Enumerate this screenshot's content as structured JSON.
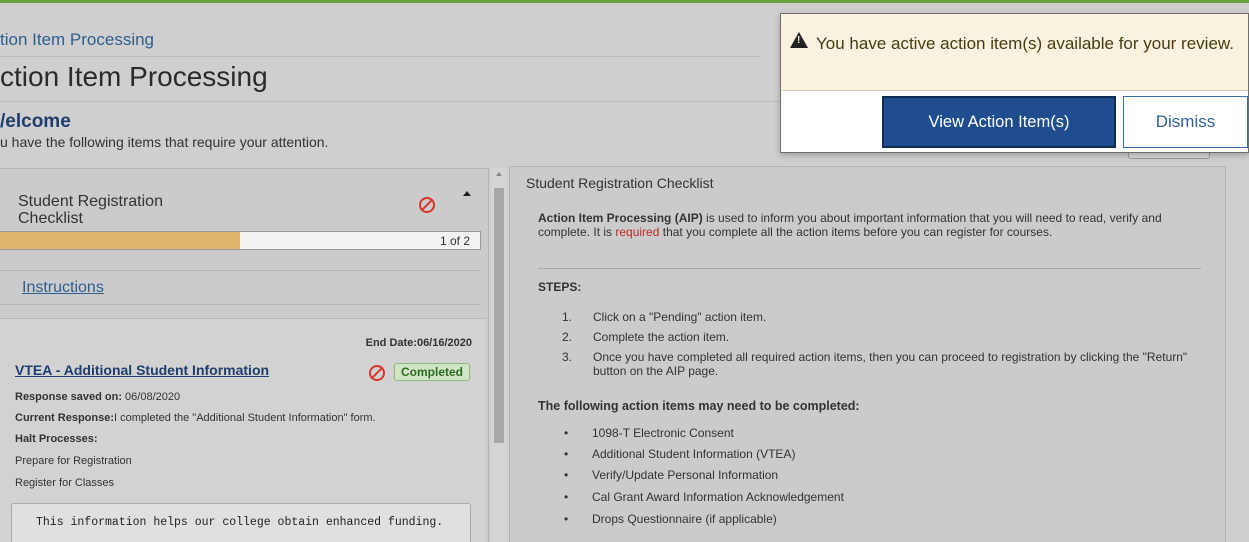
{
  "header": {
    "breadcrumb": "tion Item Processing",
    "page_title": "ction Item Processing",
    "welcome": "/elcome",
    "welcome_sub": "u have the following items that require your attention."
  },
  "checklist": {
    "title": "Student Registration Checklist",
    "progress_text": "1 of 2",
    "progress_fraction": 0.5,
    "instructions_link": "Instructions"
  },
  "item": {
    "end_date": "End Date:06/16/2020",
    "title": "VTEA - Additional Student Information",
    "status": "Completed",
    "response_saved_label": "Response saved on:",
    "response_saved_value": "06/08/2020",
    "current_response_label": "Current Response:",
    "current_response_value": "I completed the \"Additional Student Information\" form.",
    "halt_label": "Halt Processes:",
    "halt_processes": [
      "Prepare for Registration",
      "Register for Classes"
    ],
    "info_text": "This information helps our college obtain enhanced funding."
  },
  "detail": {
    "heading": "Student Registration Checklist",
    "intro_bold": "Action Item Processing (AIP)",
    "intro_1": " is used to inform you about important information that you will need to read, verify and complete. It is ",
    "intro_required": "required",
    "intro_2": " that you complete all the action items before you can register for courses.",
    "steps_label": "STEPS:",
    "steps": [
      {
        "num": "1.",
        "text": "Click on a \"Pending\" action item."
      },
      {
        "num": "2.",
        "text": "Complete the action item."
      },
      {
        "num": "3.",
        "text": "Once you have completed all required action items, then you can proceed to registration by clicking the \"Return\" button on the AIP page."
      }
    ],
    "following_label": "The following action items may need to be completed:",
    "items": [
      "1098-T Electronic Consent",
      "Additional Student Information (VTEA)",
      "Verify/Update Personal Information",
      "Cal Grant Award Information Acknowledgement",
      "Drops Questionnaire (if applicable)"
    ]
  },
  "notification": {
    "message": "You have active action item(s) available for your review.",
    "view_button": "View Action Item(s)",
    "dismiss_button": "Dismiss"
  },
  "colors": {
    "accent_green": "#6aa23f",
    "link_blue": "#2f5f8e",
    "primary_button": "#1f4d8e",
    "error_red": "#d9362a",
    "progress_fill": "#e0b56e"
  }
}
